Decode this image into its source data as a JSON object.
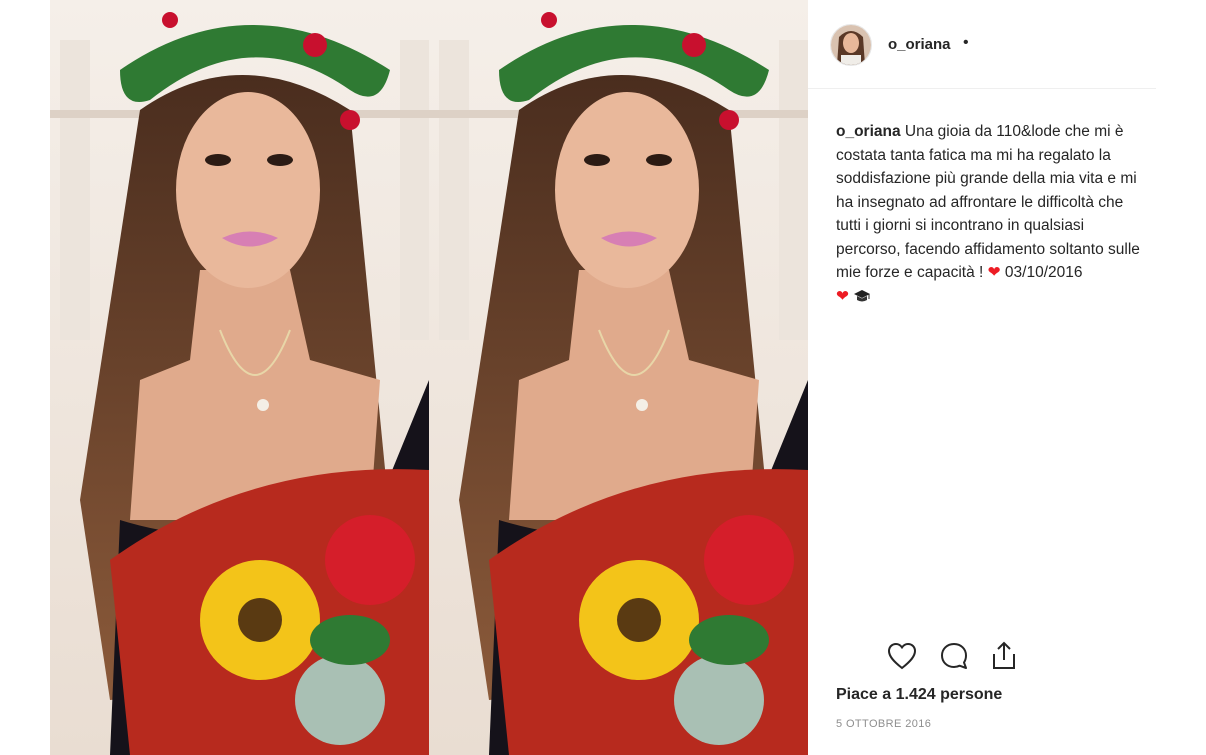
{
  "post": {
    "username": "o_oriana",
    "header_separator": "•",
    "caption": {
      "username": "o_oriana",
      "text": "Una gioia da 110&lode che mi è costata tanta fatica ma mi ha regalato la soddisfazione più grande della mia vita e mi ha insegnato ad affrontare le difficoltà che tutti i giorni si incontrano in qualsiasi percorso, facendo affidamento soltanto sulle mie forze e capacità ! ",
      "heart_emoji": "❤",
      "date_text": " 03/10/2016",
      "graduation_emoji": "🎓"
    },
    "actions": {
      "like_icon": "heart-outline-icon",
      "comment_icon": "comment-bubble-icon",
      "share_icon": "share-upload-icon"
    },
    "likes_text": "Piace a 1.424 persone",
    "timestamp": "5 OTTOBRE 2016"
  },
  "colors": {
    "text": "#262626",
    "muted": "#8e8e8e",
    "divider": "#efefef",
    "heart": "#ed1c24"
  }
}
